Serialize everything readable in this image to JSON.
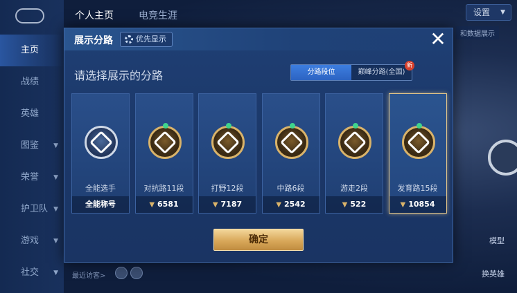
{
  "background": {
    "top_tabs": [
      {
        "label": "个人主页",
        "active": true
      },
      {
        "label": "电竞生涯",
        "active": false
      }
    ],
    "sidebar": [
      {
        "label": "主页",
        "active": true,
        "has_chevron": false
      },
      {
        "label": "战绩",
        "active": false,
        "has_chevron": false
      },
      {
        "label": "英雄",
        "active": false,
        "has_chevron": false
      },
      {
        "label": "图鉴",
        "active": false,
        "has_chevron": true
      },
      {
        "label": "荣誉",
        "active": false,
        "has_chevron": true
      },
      {
        "label": "护卫队",
        "active": false,
        "has_chevron": true
      },
      {
        "label": "游戏",
        "active": false,
        "has_chevron": true
      },
      {
        "label": "社交",
        "active": false,
        "has_chevron": true
      }
    ],
    "settings_label": "设置",
    "hint_text": "和数据展示",
    "right_labels": {
      "model": "模型",
      "switch_hero": "换英雄"
    },
    "visitors_label": "最近访客>"
  },
  "dialog": {
    "title": "展示分路",
    "priority_label": "优先显示",
    "close_glyph": "✕",
    "prompt": "请选择展示的分路",
    "toggle": [
      {
        "label": "分路段位",
        "active": true
      },
      {
        "label": "巅峰分路(全国)",
        "active": false,
        "badge": "新"
      }
    ],
    "cards": [
      {
        "name": "全能选手",
        "score": "全能称号",
        "show_arrow": false,
        "selected": false,
        "emblem": "silver-all-round-emblem"
      },
      {
        "name": "对抗路11段",
        "score": "6581",
        "show_arrow": true,
        "selected": false,
        "emblem": "clash-lane-emblem"
      },
      {
        "name": "打野12段",
        "score": "7187",
        "show_arrow": true,
        "selected": false,
        "emblem": "jungle-emblem"
      },
      {
        "name": "中路6段",
        "score": "2542",
        "show_arrow": true,
        "selected": false,
        "emblem": "mid-lane-emblem"
      },
      {
        "name": "游走2段",
        "score": "522",
        "show_arrow": true,
        "selected": false,
        "emblem": "roam-emblem"
      },
      {
        "name": "发育路15段",
        "score": "10854",
        "show_arrow": true,
        "selected": true,
        "emblem": "farm-lane-emblem"
      }
    ],
    "confirm_label": "确定"
  },
  "colors": {
    "accent_gold": "#d9b36a",
    "dialog_bg": "#1f3f74",
    "toggle_active": "#2c63c2"
  }
}
